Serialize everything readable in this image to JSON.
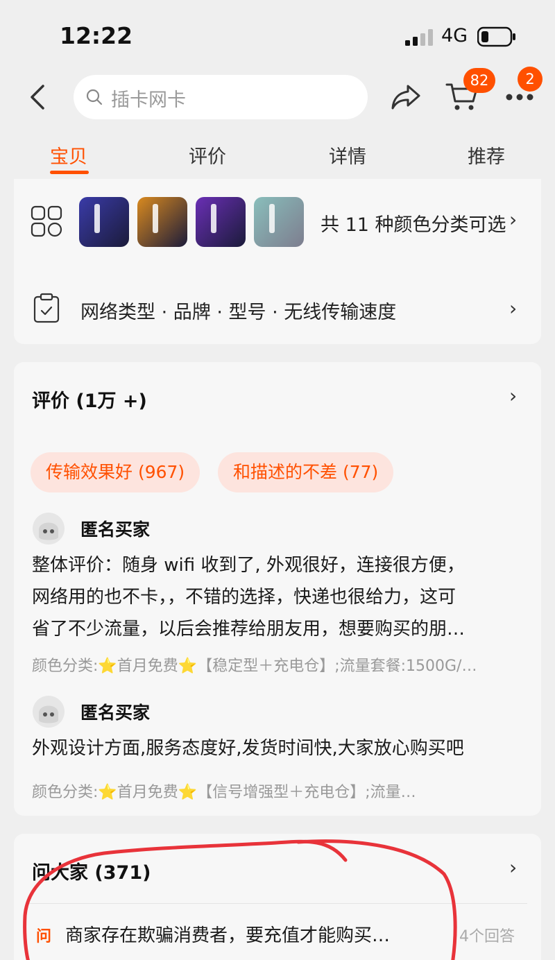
{
  "status_bar": {
    "time": "12:22",
    "network": "4G"
  },
  "nav": {
    "search_placeholder": "插卡网卡",
    "cart_count": "82",
    "more_count": "2"
  },
  "tabs": [
    {
      "label": "宝贝",
      "active": true
    },
    {
      "label": "评价",
      "active": false
    },
    {
      "label": "详情",
      "active": false
    },
    {
      "label": "推荐",
      "active": false
    }
  ],
  "sku": {
    "thumb_colors": [
      "#3a3ba8",
      "#d98a1f",
      "#6a2fb5",
      "#2f8f8a"
    ],
    "color_options_text": "共 11 种颜色分类可选"
  },
  "specs": {
    "text": "网络类型 · 品牌 · 型号 · 无线传输速度"
  },
  "reviews": {
    "title": "评价 (1万 +)",
    "tags": [
      "传输效果好 (967)",
      "和描述的不差 (77)"
    ],
    "items": [
      {
        "user": "匿名买家",
        "lines": [
          "整体评价：随身 wifi 收到了, 外观很好，连接很方便，",
          "网络用的也不卡，，不错的选择，快递也很给力，这可",
          "省了不少流量，以后会推荐给朋友用，想要购买的朋…"
        ],
        "meta": "颜色分类:⭐首月免费⭐【稳定型＋充电仓】;流量套餐:1500G/…"
      },
      {
        "user": "匿名买家",
        "lines": [
          "外观设计方面,服务态度好,发货时间快,大家放心购买吧"
        ],
        "meta": "颜色分类:⭐首月免费⭐【信号增强型＋充电仓】;流量…"
      }
    ]
  },
  "qa": {
    "title": "问大家 (371)",
    "icon_label": "问",
    "question": "商家存在欺骗消费者，要充值才能购买…",
    "answer_count": "4个回答"
  },
  "colors": {
    "accent": "#ff5000",
    "tag_bg": "#fde4de",
    "annotation": "#e8333a"
  }
}
